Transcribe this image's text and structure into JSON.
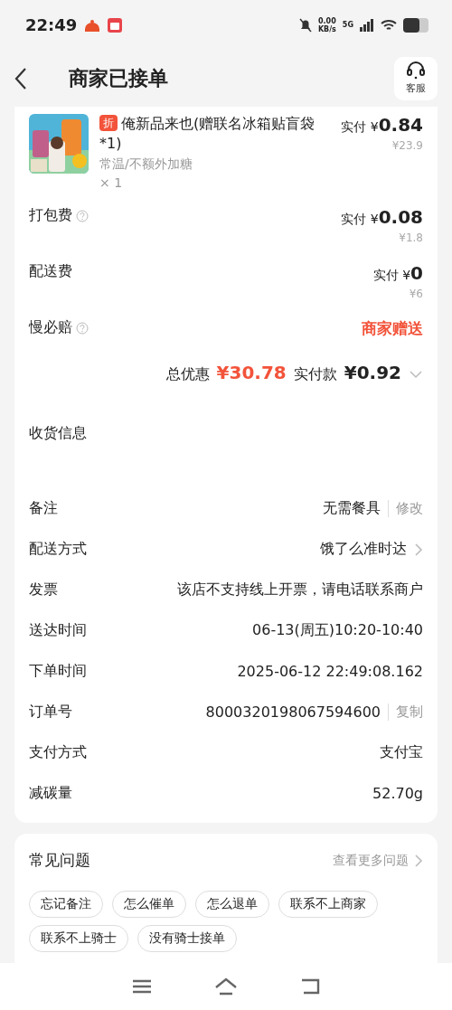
{
  "status_bar": {
    "time": "22:49",
    "net_speed": "0.00",
    "net_unit": "KB/s",
    "network": "5G"
  },
  "header": {
    "title": "商家已接单",
    "service_label": "客服"
  },
  "product": {
    "badge": "折",
    "name": "俺新品来也(赠联名冰箱贴盲袋*1)",
    "spec": "常温/不额外加糖",
    "quantity": "× 1",
    "paid_label": "实付",
    "currency": "¥",
    "price": "0.84",
    "original": "¥23.9"
  },
  "fees": [
    {
      "kind": "price",
      "label": "打包费",
      "help": true,
      "paid_label": "实付",
      "currency": "¥",
      "price": "0.08",
      "original": "¥1.8"
    },
    {
      "kind": "price",
      "label": "配送费",
      "help": false,
      "paid_label": "实付",
      "currency": "¥",
      "price": "0",
      "original": "¥6"
    },
    {
      "kind": "text",
      "label": "慢必赔",
      "help": true,
      "value": "商家赠送"
    }
  ],
  "summary": {
    "discount_label": "总优惠",
    "discount": "¥30.78",
    "total_label": "实付款",
    "total": "¥0.92"
  },
  "delivery_title": "收货信息",
  "details": [
    {
      "label": "备注",
      "value": "无需餐具",
      "action": "修改",
      "chevron": false
    },
    {
      "label": "配送方式",
      "value": "饿了么准时达",
      "chevron": true
    },
    {
      "label": "发票",
      "value": "该店不支持线上开票，请电话联系商户",
      "chevron": false
    },
    {
      "label": "送达时间",
      "value": "06-13(周五)10:20-10:40",
      "chevron": false
    },
    {
      "label": "下单时间",
      "value": "2025-06-12 22:49:08.162",
      "chevron": false
    },
    {
      "label": "订单号",
      "value": "8000320198067594600",
      "action": "复制",
      "chevron": false
    },
    {
      "label": "支付方式",
      "value": "支付宝",
      "chevron": false
    },
    {
      "label": "减碳量",
      "value": "52.70g",
      "chevron": false
    }
  ],
  "faq": {
    "title": "常见问题",
    "more": "查看更多问题",
    "chips": [
      "忘记备注",
      "怎么催单",
      "怎么退单",
      "联系不上商家",
      "联系不上骑士",
      "没有骑士接单"
    ]
  }
}
